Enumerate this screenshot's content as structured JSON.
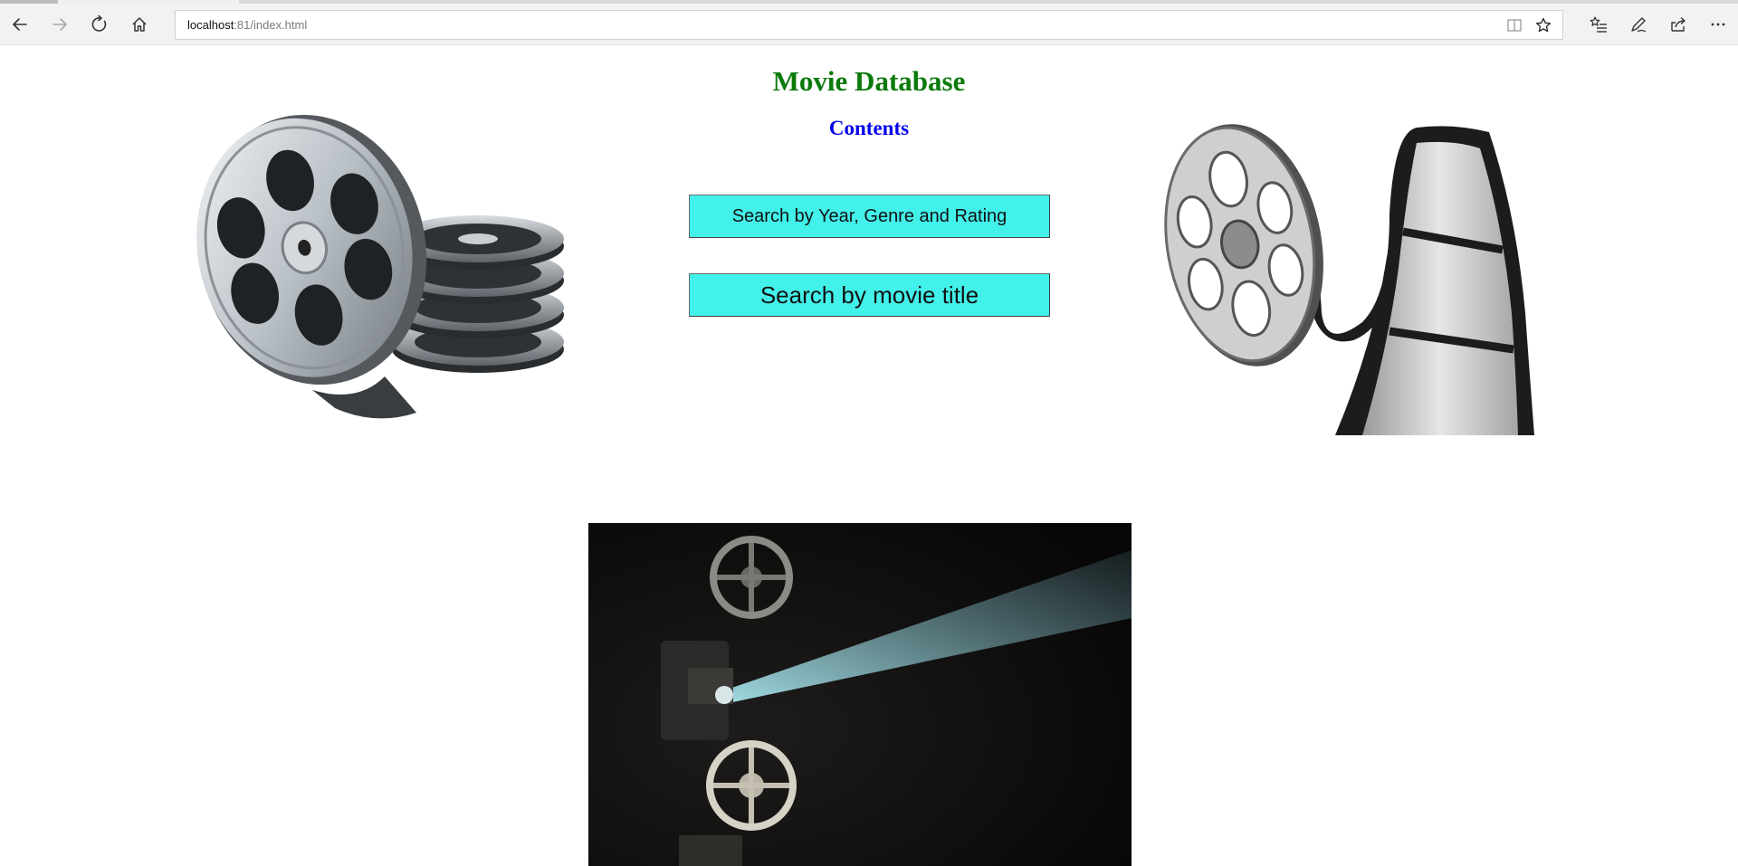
{
  "browser": {
    "address": {
      "host": "localhost",
      "rest": ":81/index.html"
    },
    "icons": {
      "back": "back-arrow-icon",
      "forward": "forward-arrow-icon",
      "refresh": "refresh-icon",
      "home": "home-icon",
      "reading_view": "reading-view-icon",
      "favorite": "star-icon",
      "favorites_hub": "favorites-list-icon",
      "notes": "pen-icon",
      "share": "share-icon",
      "more": "more-icon"
    }
  },
  "page": {
    "title": "Movie Database",
    "subtitle": "Contents",
    "buttons": {
      "search_year_genre_rating": "Search by Year, Genre and Rating",
      "search_title": "Search by movie title"
    },
    "colors": {
      "title": "#0a7a0a",
      "subtitle": "#0000ee",
      "button_bg": "#42f1ea"
    }
  }
}
